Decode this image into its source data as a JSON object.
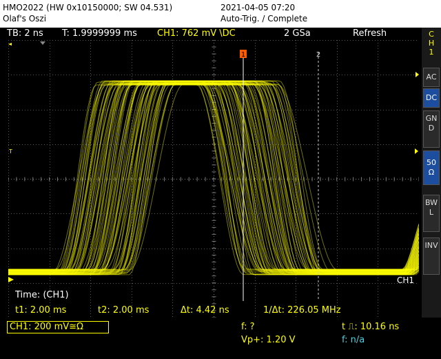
{
  "header": {
    "model": "HMO2022 (HW 0x10150000; SW 04.531)",
    "name": "Olaf's Oszi",
    "datetime": "2021-04-05 07:20",
    "status": "Auto-Trig. / Complete"
  },
  "statusbar": {
    "timebase": "TB: 2 ns",
    "trigger_time": "T: 1.9999999 ms",
    "ch1_trigger": "CH1: 762 mV \\DC",
    "sample_rate": "2 GSa",
    "mode": "Refresh"
  },
  "sidebar": {
    "channel_label": [
      "C",
      "H",
      "1"
    ],
    "buttons": [
      {
        "label": "AC",
        "active": false
      },
      {
        "label": "DC",
        "active": true
      },
      {
        "label": "GND",
        "active": false
      },
      {
        "label": "50Ω",
        "active": true
      },
      {
        "label": "BWL",
        "active": false
      },
      {
        "label": "INV",
        "active": false
      }
    ]
  },
  "screen": {
    "trigger_marker": "1",
    "cursor2_marker": "2",
    "ch_label": "CH1",
    "level_marker": "T",
    "ground_marker": "1"
  },
  "readouts": {
    "title": "Time: (CH1)",
    "t1": "t1: 2.00 ms",
    "t2": "t2: 2.00 ms",
    "dt": "Δt: 4.42 ns",
    "inv_dt": "1/Δt: 226.05 MHz"
  },
  "bottom": {
    "ch1_setting": "CH1: 200 mV≅Ω",
    "freq": "f: ?",
    "vpp": "Vp+: 1.20 V",
    "pulse_width": "t ⎍: 10.16 ns",
    "freq2": "f: n/a"
  },
  "colors": {
    "trace": "#ffff00",
    "grid": "#5a5a5a",
    "accent_active": "#1d4d9e",
    "cursor_marker": "#ff5a00"
  }
}
